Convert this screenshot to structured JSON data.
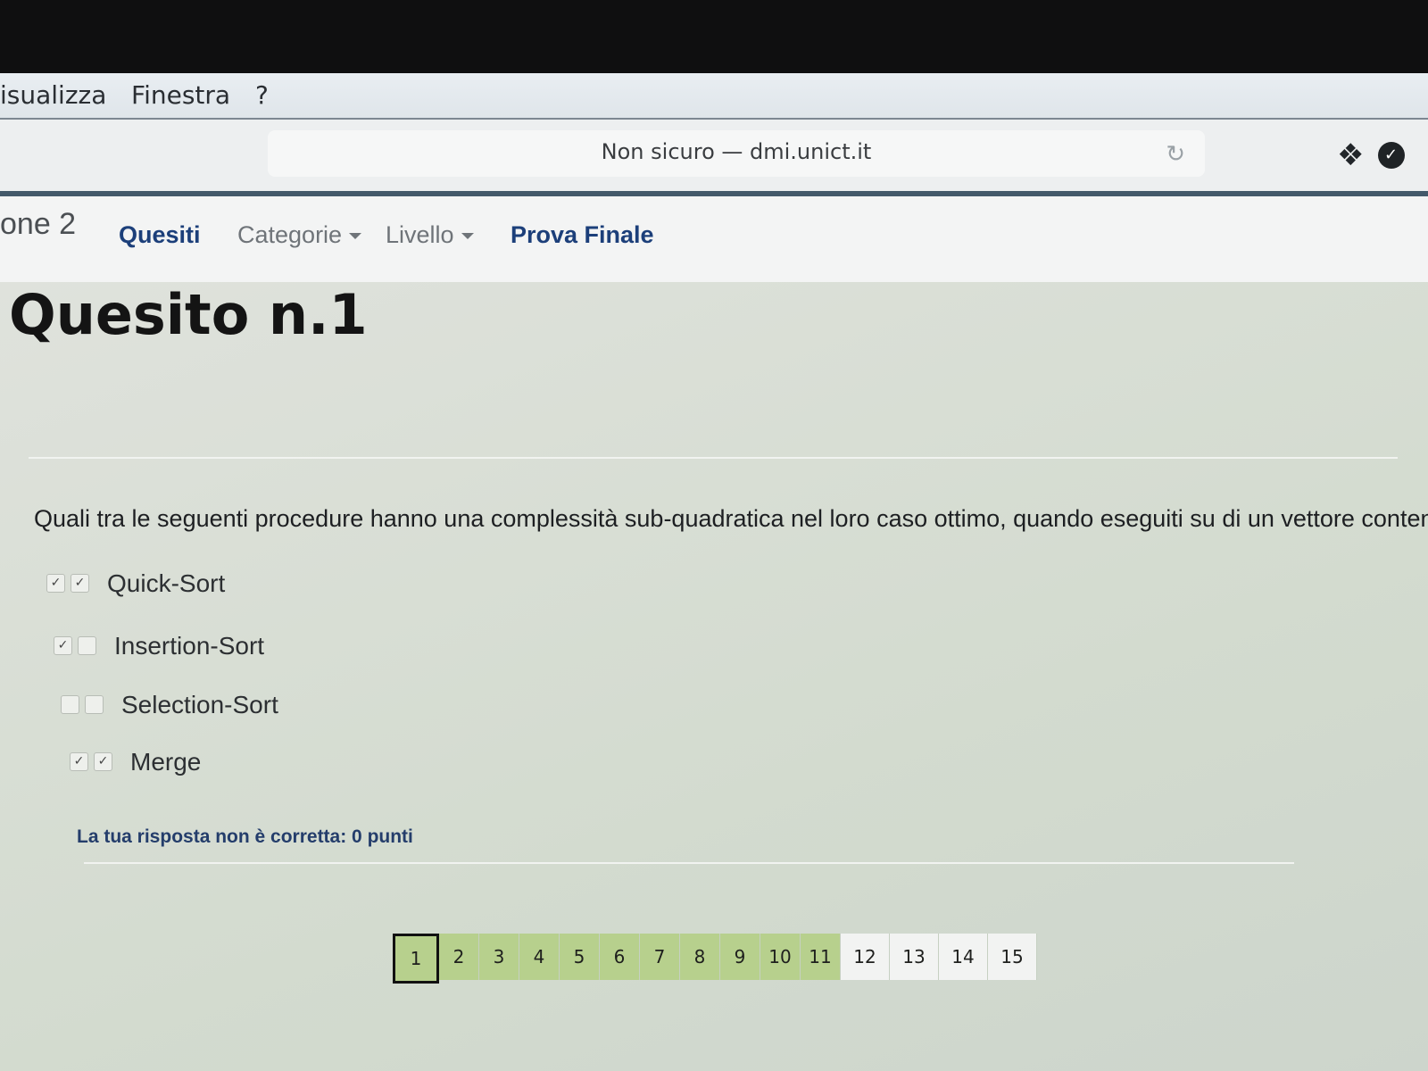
{
  "menubar": {
    "items": [
      "isualizza",
      "Finestra",
      "?"
    ]
  },
  "browser": {
    "url": "Non sicuro — dmi.unict.it",
    "reload_glyph": "↻",
    "ext_dropbox_glyph": "❖",
    "ext_check_glyph": "✓"
  },
  "nav": {
    "brand": "one 2",
    "items": [
      {
        "label": "Quesiti",
        "style": "active"
      },
      {
        "label": "Categorie",
        "style": "dropdown"
      },
      {
        "label": "Livello",
        "style": "dropdown"
      },
      {
        "label": "Prova Finale",
        "style": "active"
      }
    ]
  },
  "quiz": {
    "title": "Quesito n.1",
    "question": "Quali tra le seguenti procedure hanno una complessità sub-quadratica nel loro caso ottimo, quando eseguiti su di un vettore contenente n elementi?",
    "options": [
      {
        "label": "Quick-Sort",
        "correct": true,
        "selected": true
      },
      {
        "label": "Insertion-Sort",
        "correct": true,
        "selected": false
      },
      {
        "label": "Selection-Sort",
        "correct": false,
        "selected": false
      },
      {
        "label": "Merge",
        "correct": true,
        "selected": true
      }
    ],
    "check_glyph": "✓",
    "feedback": "La tua risposta non è corretta: 0 punti"
  },
  "pagination": {
    "pages": [
      "1",
      "2",
      "3",
      "4",
      "5",
      "6",
      "7",
      "8",
      "9",
      "10",
      "11",
      "12",
      "13",
      "14",
      "15"
    ],
    "current": "1",
    "answered_through": 11
  },
  "colors": {
    "nav_active": "#1c3f7a",
    "answered_page": "#b7d08d",
    "feedback": "#243d6b"
  }
}
